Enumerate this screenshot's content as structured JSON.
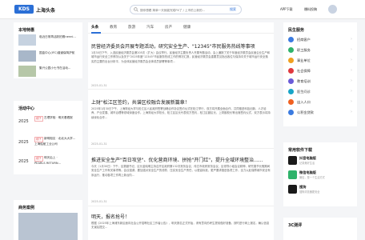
{
  "header": {
    "logo": "KDS",
    "site_name": "上海头条",
    "search_placeholder": "搜你想看 简单一天就能完成PX了 / 上市的上新的...",
    "search_button": "搜索",
    "links": [
      "APP下载",
      "爆料投稿"
    ]
  },
  "left": {
    "local_title": "本地特惠",
    "local_items": [
      "临近日常再活跃拍照nenni...",
      "国金中心(IFC)普道保驾护航",
      "集兴公园小七书在活动..."
    ],
    "activity_title": "活动中心",
    "activities": [
      {
        "year": "2025",
        "tag": "线下",
        "text": "古理学相 · 明天看看报",
        "sub": ""
      },
      {
        "year": "2025",
        "tag": "线下",
        "text": "新明相见 · 北北大大学...",
        "sub": "上海船舶工业公司"
      },
      {
        "year": "2025",
        "tag": "线下",
        "text": "明天后上 ·",
        "sub": "PEARLS RETURN..."
      }
    ],
    "business_title": "商务案例"
  },
  "tabs": [
    "头条",
    "教育",
    "旅游",
    "汽车",
    "房产",
    "健康"
  ],
  "articles": [
    {
      "title": "民营经济委员会开展专题活动，研究安全生产、\"12345\"市民服务热线等事项",
      "body": "1月30日下午，入选民营经济委员会第205次（扩大）会议举行。民营经济主要负责人开展专题活动，会上通报了关于年度经济委员会民营企业生产和城市运行安全工作情况以及关于\"2025年度\"12345\"市民服务热线工作的情况汇报，民营经济委员会重要意见指出各位与保持中关于城市运行安全落实的主要的出台分析平，为全体民营经济委员会全体成员部署等事项...",
      "meta": "2025-01-31"
    },
    {
      "title": "上财\"松江区签约，共谱区校融合发展新篇章！",
      "body": "2025年1月30日下午，上海财经大学与松江区人民政府签署战略合作协议签约仪式在松江举行，双方将开展全面合作，共同推进科技创新、人才培养、产业发展、城市治理等领域深度合作。上海财经大学校长、松江区区长代表双方签约，松江区副区长、上财副校长等出席签约仪式，双方表示将持续深化合作...",
      "meta": "2025-01-31"
    },
    {
      "title": "推进安全生产\"百日攻坚\"、优化营商环境、拼抢\"开门红\"，提升全域环境整治......",
      "body": "今天（1月30日）下午，区委副书记、区长金晓明主持召开区政府第132次常务会议，传达市政府常务会议、区领导小组会议精神，研究春节长假期间安全生产工作有关事项等。会议强调，要加强对安全生产的领导，压实安全生产责任，以更高标准、更严要求推进各项工作，全力以赴保障城市安全有序运行，推动各项工作再上新台阶...",
      "meta": "2025-01-31"
    },
    {
      "title": "明天，报名抢号！",
      "body": "根据《2025年上海浦东新区面向社会公开招聘社区工作者公告》，明天报名正式开始，请有意向的考生提前做好准备，按时进行网上报名，确认信息无误后提交...",
      "meta": ""
    }
  ],
  "right": {
    "services_title": "民生服务",
    "services": [
      {
        "label": "招商客户",
        "color": "#3b7be0"
      },
      {
        "label": "职工服务",
        "color": "#2fb36b"
      },
      {
        "label": "事业单位",
        "color": "#f0a020"
      },
      {
        "label": "社会保障",
        "color": "#e0383e"
      },
      {
        "label": "教育培训",
        "color": "#6a5bd8"
      },
      {
        "label": "医生问诊",
        "color": "#18a5c8"
      },
      {
        "label": "出入人口",
        "color": "#f06020"
      },
      {
        "label": "公积金贷款",
        "color": "#3b7be0"
      }
    ],
    "apps_title": "常用软件下载",
    "apps": [
      {
        "name": "抖音电脑版",
        "desc": "记录美好生活",
        "color": "#1a1a1a"
      },
      {
        "name": "微信电脑版",
        "desc": "微信，是一个生活方式",
        "color": "#2fb36b"
      },
      {
        "name": "搜狗",
        "desc": "搜狗浏览器更安全",
        "color": "#1a1a1a"
      }
    ],
    "news_title": "3C测评"
  }
}
